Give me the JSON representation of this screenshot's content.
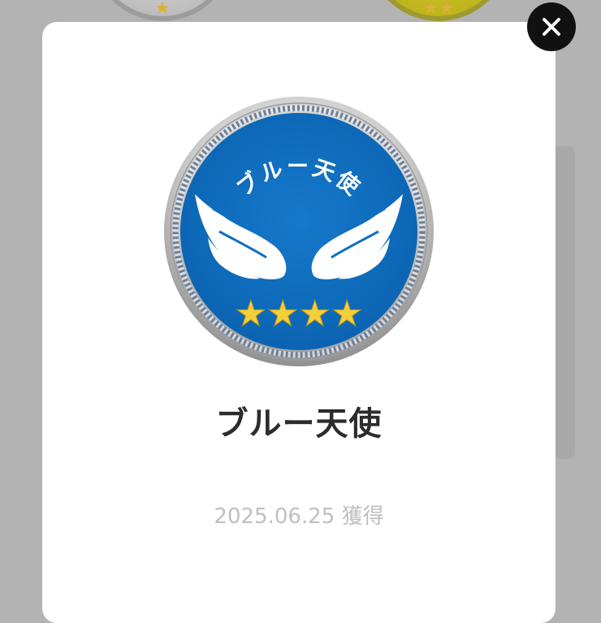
{
  "background": {
    "medals": [
      {
        "stars": "★"
      },
      {
        "stars": "★★"
      }
    ]
  },
  "modal": {
    "medal": {
      "emblem_text": "ブルー天使",
      "stars": "★★★★",
      "colors": {
        "face": "#0f6fc0",
        "rim": "#c7c7c7",
        "star": "#f3cf3a"
      }
    },
    "badge_name": "ブルー天使",
    "acquired_date": "2025.06.25",
    "acquired_label": "獲得"
  },
  "close_icon": "close-icon"
}
